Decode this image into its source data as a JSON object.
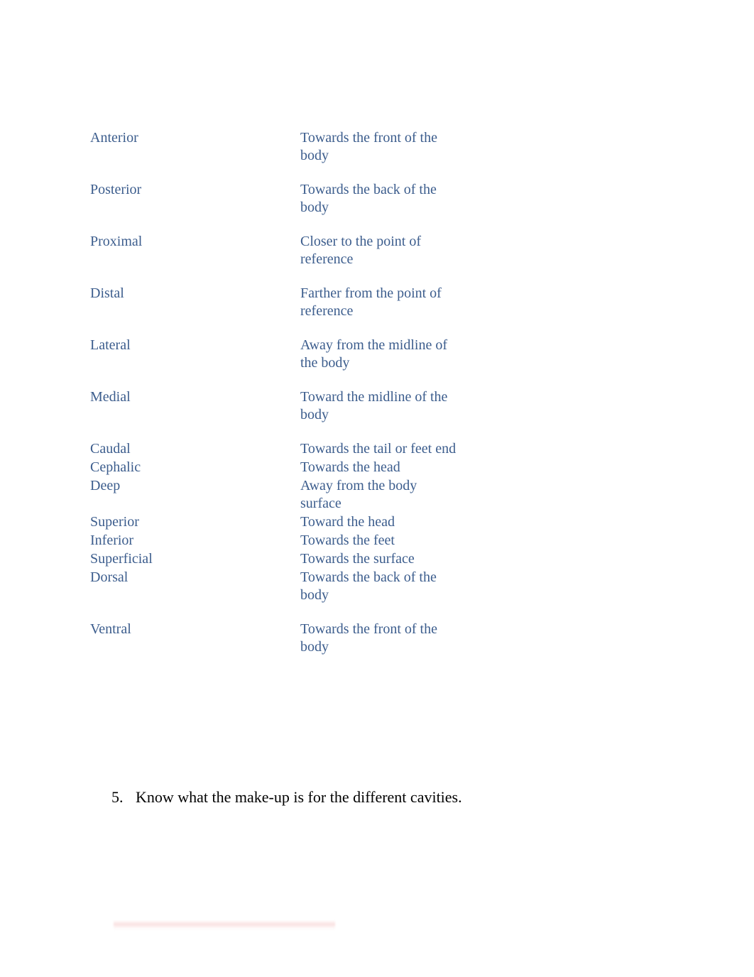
{
  "document": {
    "text_color": "#3c5d8d",
    "body_color": "#000000",
    "background": "#ffffff"
  },
  "terms_table": {
    "rows": [
      {
        "term": "Anterior",
        "definition": "Towards the front of the body"
      },
      {
        "term": "Posterior",
        "definition": "Towards the back of the body"
      },
      {
        "term": "Proximal",
        "definition": "Closer to the point of reference"
      },
      {
        "term": "Distal",
        "definition": "Farther from the point of reference"
      },
      {
        "term": "Lateral",
        "definition": "Away from the midline of the body"
      },
      {
        "term": "Medial",
        "definition": "Toward the midline of the body"
      },
      {
        "term": "Caudal",
        "definition": "Towards the tail or feet end"
      },
      {
        "term": "Cephalic",
        "definition": "Towards the head"
      },
      {
        "term": "Deep",
        "definition": "Away from the body surface"
      },
      {
        "term": "Superior",
        "definition": "Toward the head"
      },
      {
        "term": "Inferior",
        "definition": "Towards the feet"
      },
      {
        "term": "Superficial",
        "definition": "Towards the surface"
      },
      {
        "term": "Dorsal",
        "definition": "Towards the back of the body"
      },
      {
        "term": "Ventral",
        "definition": "Towards the front of the body"
      }
    ]
  },
  "numbered_list": {
    "items": [
      {
        "number": "5.",
        "text": "Know what the make-up is for the different cavities."
      }
    ]
  }
}
